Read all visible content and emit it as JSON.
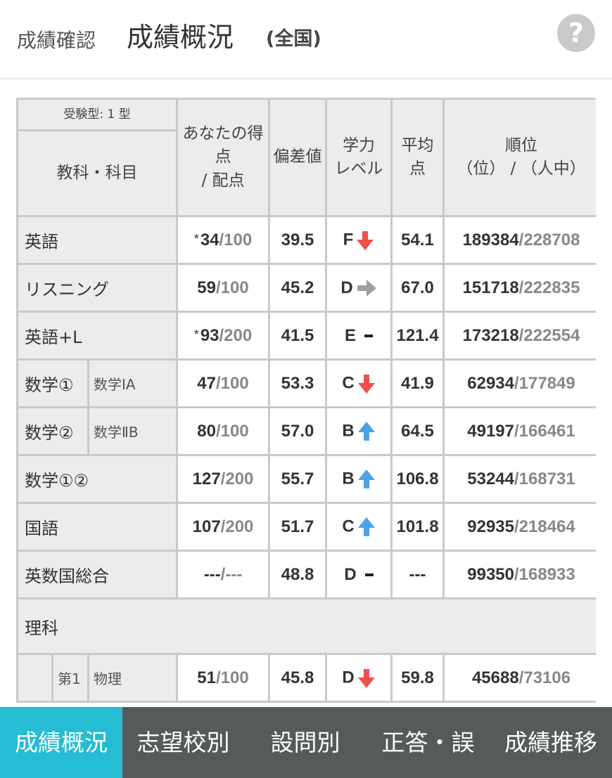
{
  "header": {
    "breadcrumb": "成績確認",
    "title": "成績概況",
    "scope": "(全国)",
    "help_label": "?"
  },
  "table": {
    "exam_type": "受験型: 1 型",
    "col_subject": "教科・科目",
    "col_score": [
      "あなたの得",
      "点",
      "/ 配点"
    ],
    "col_deviation": "偏差値",
    "col_level": [
      "学力",
      "レベル"
    ],
    "col_average": [
      "平均",
      "点"
    ],
    "col_rank": [
      "順位",
      "（位） / （人中）"
    ],
    "rows": [
      {
        "subject": "英語",
        "asterisk": "*",
        "score": "34",
        "max": "/100",
        "deviation": "39.5",
        "level": "F",
        "trend": "down",
        "average": "54.1",
        "rank": "189384",
        "total": "/228708"
      },
      {
        "subject": "リスニング",
        "score": "59",
        "max": "/100",
        "deviation": "45.2",
        "level": "D",
        "trend": "flat",
        "average": "67.0",
        "rank": "151718",
        "total": "/222835"
      },
      {
        "subject": "英語+L",
        "asterisk": "*",
        "score": "93",
        "max": "/200",
        "deviation": "41.5",
        "level": "E",
        "trend": "dash",
        "average": "121.4",
        "rank": "173218",
        "total": "/222554"
      },
      {
        "subject": "数学①",
        "sub": "数学ⅠA",
        "score": "47",
        "max": "/100",
        "deviation": "53.3",
        "level": "C",
        "trend": "down",
        "average": "41.9",
        "rank": "62934",
        "total": "/177849"
      },
      {
        "subject": "数学②",
        "sub": "数学ⅡB",
        "score": "80",
        "max": "/100",
        "deviation": "57.0",
        "level": "B",
        "trend": "up",
        "average": "64.5",
        "rank": "49197",
        "total": "/166461"
      },
      {
        "subject": "数学①②",
        "score": "127",
        "max": "/200",
        "deviation": "55.7",
        "level": "B",
        "trend": "up",
        "average": "106.8",
        "rank": "53244",
        "total": "/168731"
      },
      {
        "subject": "国語",
        "score": "107",
        "max": "/200",
        "deviation": "51.7",
        "level": "C",
        "trend": "up",
        "average": "101.8",
        "rank": "92935",
        "total": "/218464"
      },
      {
        "subject": "英数国総合",
        "score": "---",
        "max": "/---",
        "deviation": "48.8",
        "level": "D",
        "trend": "dash",
        "average": "---",
        "rank": "99350",
        "total": "/168933"
      }
    ],
    "science_label": "理科",
    "science_rows": [
      {
        "order": "第1",
        "subject": "物理",
        "score": "51",
        "max": "/100",
        "deviation": "45.8",
        "level": "D",
        "trend": "down",
        "average": "59.8",
        "rank": "45688",
        "total": "/73106"
      }
    ]
  },
  "tabs": [
    {
      "label": "成績概況",
      "active": true
    },
    {
      "label": "志望校別",
      "active": false
    },
    {
      "label": "設問別",
      "active": false
    },
    {
      "label": "正答・誤",
      "active": false
    },
    {
      "label": "成績推移",
      "active": false
    }
  ],
  "colors": {
    "accent": "#25bdd3",
    "tabbar": "#555a5a",
    "down": "#f0504d",
    "up": "#4aa3e8",
    "flat": "#a0a0a0"
  }
}
